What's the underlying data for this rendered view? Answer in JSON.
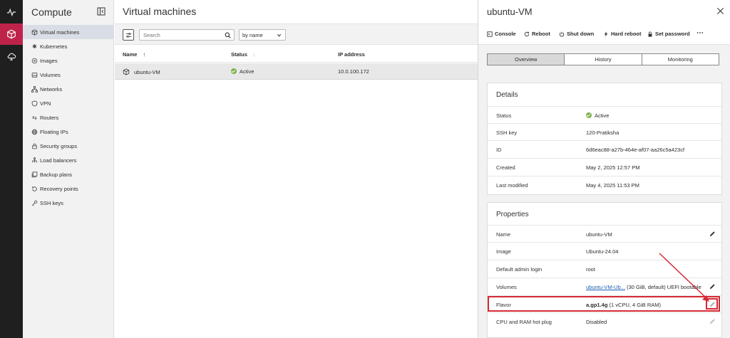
{
  "colors": {
    "accent": "#c0234a",
    "active_status": "#7bb24a",
    "highlight": "#d42a35",
    "link": "#1b5fb0"
  },
  "rail": {
    "items": [
      {
        "icon": "activity-icon"
      },
      {
        "icon": "cube-icon",
        "active": true
      },
      {
        "icon": "cloud-icon"
      }
    ]
  },
  "nav": {
    "title": "Compute",
    "items": [
      {
        "label": "Virtual machines",
        "icon": "cube-icon",
        "active": true
      },
      {
        "label": "Kubernetes",
        "icon": "kubernetes-icon"
      },
      {
        "label": "Images",
        "icon": "disc-icon"
      },
      {
        "label": "Volumes",
        "icon": "drive-icon"
      },
      {
        "label": "Networks",
        "icon": "network-icon"
      },
      {
        "label": "VPN",
        "icon": "shield-icon"
      },
      {
        "label": "Routers",
        "icon": "router-icon"
      },
      {
        "label": "Floating IPs",
        "icon": "globe-icon"
      },
      {
        "label": "Security groups",
        "icon": "lock-icon"
      },
      {
        "label": "Load balancers",
        "icon": "balancer-icon"
      },
      {
        "label": "Backup plans",
        "icon": "backup-icon"
      },
      {
        "label": "Recovery points",
        "icon": "recovery-icon"
      },
      {
        "label": "SSH keys",
        "icon": "key-icon"
      }
    ]
  },
  "main": {
    "title": "Virtual machines",
    "search": {
      "placeholder": "Search",
      "value": ""
    },
    "sort": {
      "selected": "by name"
    },
    "columns": [
      "Name",
      "Status",
      "IP address"
    ],
    "rows": [
      {
        "name": "ubuntu-VM",
        "status": "Active",
        "ip": "10.0.100.172"
      }
    ]
  },
  "panel": {
    "title": "ubuntu-VM",
    "actions": [
      {
        "label": "Console",
        "icon": "console-icon"
      },
      {
        "label": "Reboot",
        "icon": "reboot-icon"
      },
      {
        "label": "Shut down",
        "icon": "power-icon"
      },
      {
        "label": "Hard reboot",
        "icon": "bolt-icon"
      },
      {
        "label": "Set password",
        "icon": "lock-icon"
      },
      {
        "label": "⋯",
        "icon": "more-icon"
      }
    ],
    "tabs": [
      {
        "label": "Overview",
        "active": true
      },
      {
        "label": "History"
      },
      {
        "label": "Monitoring"
      }
    ],
    "details": {
      "title": "Details",
      "rows": [
        {
          "key": "Status",
          "value": "Active"
        },
        {
          "key": "SSH key",
          "value": "120-Pratiksha"
        },
        {
          "key": "ID",
          "value": "6d6eac88-a27b-464e-af07-aa26c5a423cf"
        },
        {
          "key": "Created",
          "value": "May 2, 2025 12:57 PM"
        },
        {
          "key": "Last modified",
          "value": "May 4, 2025 11:53 PM"
        }
      ]
    },
    "properties": {
      "title": "Properties",
      "name": {
        "key": "Name",
        "value": "ubuntu-VM"
      },
      "image": {
        "key": "Image",
        "value": "Ubuntu-24.04"
      },
      "admin": {
        "key": "Default admin login",
        "value": "root"
      },
      "volumes": {
        "key": "Volumes",
        "link": "ubuntu-VM-Ub...",
        "rest": " (30 GiB, default) UEFI bootable"
      },
      "flavor": {
        "key": "Flavor",
        "bold": "a.gp1.4g",
        "rest": " (1 vCPU, 4 GiB RAM)"
      },
      "hotplug": {
        "key": "CPU and RAM hot plug",
        "value": "Disabled"
      }
    }
  }
}
